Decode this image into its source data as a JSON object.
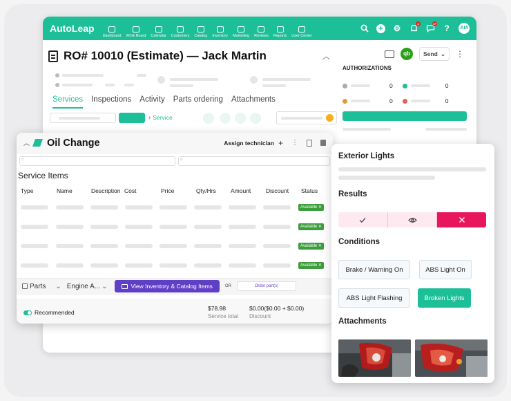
{
  "nav": {
    "logo": "AutoLeap",
    "items": [
      "Dashboard",
      "Work Board",
      "Calendar",
      "Customers",
      "Catalog",
      "Inventory",
      "Marketing",
      "Reviews",
      "Reports",
      "User Center"
    ],
    "avatar": "AM",
    "help": "?",
    "badges": {
      "bell": "4",
      "chat": "3+"
    },
    "accent": "#1dbf98"
  },
  "ro": {
    "title": "RO# 10010 (Estimate) — Jack Martin",
    "tabs": [
      "Services",
      "Inspections",
      "Activity",
      "Parts ordering",
      "Attachments"
    ],
    "add_service": "+ Service",
    "send": "Send",
    "qb": "qb"
  },
  "authorizations": {
    "title": "AUTHORIZATIONS",
    "counts": [
      "0",
      "0",
      "0",
      "0"
    ]
  },
  "oil_change": {
    "title": "Oil Change",
    "assign": "Assign technician",
    "service_items_title": "Service Items",
    "columns": [
      "Type",
      "Name",
      "Description",
      "Cost",
      "Price",
      "Qty/Hrs",
      "Amount",
      "Discount",
      "Status"
    ],
    "rows": [
      {
        "status": "Available"
      },
      {
        "status": "Available"
      },
      {
        "status": "Available"
      },
      {
        "status": "Available"
      }
    ],
    "parts_label": "Parts",
    "engine_label": "Engine A...",
    "view_inventory": "View Inventory & Catalog Items",
    "or": "OR",
    "order_parts": "Order part(s)",
    "recommended": "Recommended",
    "total": "$78.98",
    "total_label": "Service total",
    "discount": "$0.00($0.00 + $0.00)",
    "discount_label": "Discount"
  },
  "exterior": {
    "title": "Exterior Lights",
    "results_title": "Results",
    "conditions_title": "Conditions",
    "conditions": [
      "Brake / Warning On",
      "ABS Light On",
      "ABS Light Flashing",
      "Broken Lights"
    ],
    "attachments_title": "Attachments"
  }
}
